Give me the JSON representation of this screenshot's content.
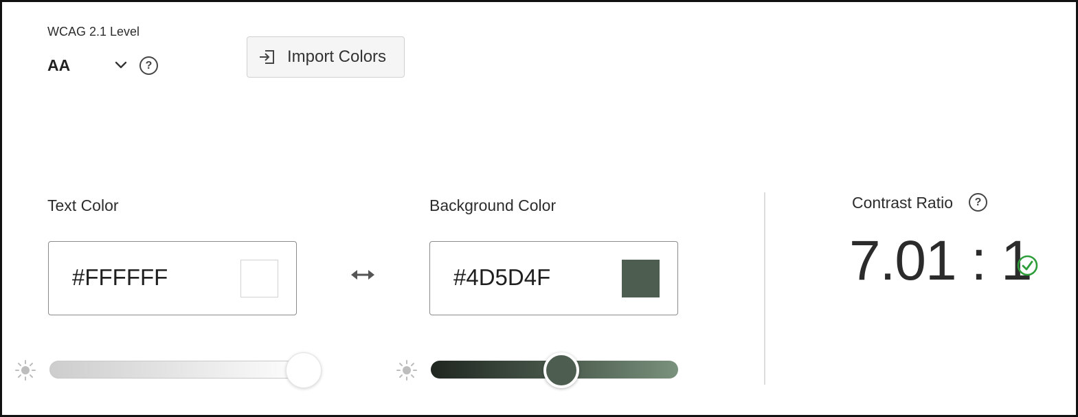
{
  "wcag": {
    "label": "WCAG 2.1 Level",
    "selected": "AA",
    "help_symbol": "?"
  },
  "import_button": {
    "label": "Import Colors",
    "icon": "import-icon"
  },
  "text_color": {
    "label": "Text Color",
    "hex": "#FFFFFF",
    "swatch_color": "#FFFFFF",
    "icon": "brightness-icon"
  },
  "swap": {
    "icon": "swap-arrows-icon"
  },
  "background_color": {
    "label": "Background Color",
    "hex": "#4D5D4F",
    "swatch_color": "#4D5D4F",
    "icon": "brightness-icon"
  },
  "contrast": {
    "label": "Contrast Ratio",
    "help_symbol": "?",
    "ratio": "7.01 : 1",
    "status_icon": "checkmark-circle-icon",
    "status_color": "#2d9d3a"
  }
}
